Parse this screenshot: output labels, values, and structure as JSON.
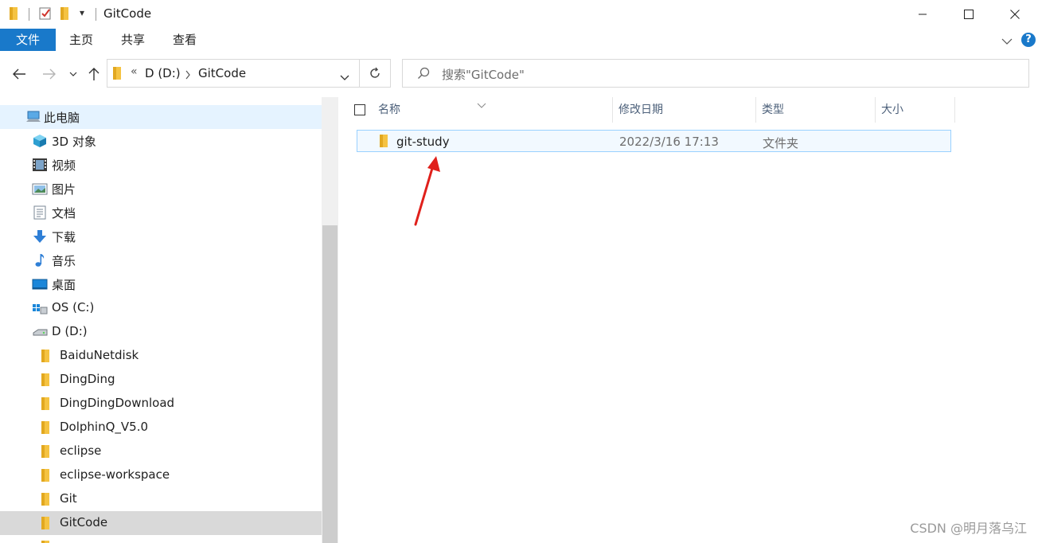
{
  "window": {
    "title": "GitCode",
    "quick_access_dropdown": "▾"
  },
  "ribbon": {
    "tabs": [
      {
        "label": "文件"
      },
      {
        "label": "主页"
      },
      {
        "label": "共享"
      },
      {
        "label": "查看"
      }
    ],
    "help": "?"
  },
  "address": {
    "prefix": "«",
    "path": [
      {
        "label": "D (D:)"
      },
      {
        "label": "GitCode"
      }
    ],
    "search_placeholder": "搜索\"GitCode\""
  },
  "nav": {
    "items": [
      {
        "label": "此电脑",
        "icon": "computer-icon"
      },
      {
        "label": "3D 对象",
        "icon": "3d-objects-icon"
      },
      {
        "label": "视频",
        "icon": "video-icon"
      },
      {
        "label": "图片",
        "icon": "pictures-icon"
      },
      {
        "label": "文档",
        "icon": "documents-icon"
      },
      {
        "label": "下载",
        "icon": "downloads-icon"
      },
      {
        "label": "音乐",
        "icon": "music-icon"
      },
      {
        "label": "桌面",
        "icon": "desktop-icon"
      },
      {
        "label": "OS (C:)",
        "icon": "windows-drive-icon"
      },
      {
        "label": "D (D:)",
        "icon": "drive-icon"
      },
      {
        "label": "BaiduNetdisk",
        "icon": "folder-icon"
      },
      {
        "label": "DingDing",
        "icon": "folder-icon"
      },
      {
        "label": "DingDingDownload",
        "icon": "folder-icon"
      },
      {
        "label": "DolphinQ_V5.0",
        "icon": "folder-icon"
      },
      {
        "label": "eclipse",
        "icon": "folder-icon"
      },
      {
        "label": "eclipse-workspace",
        "icon": "folder-icon"
      },
      {
        "label": "Git",
        "icon": "folder-icon"
      },
      {
        "label": "GitCode",
        "icon": "folder-icon"
      }
    ]
  },
  "columns": {
    "name": "名称",
    "date": "修改日期",
    "type": "类型",
    "size": "大小"
  },
  "files": [
    {
      "name": "git-study",
      "date": "2022/3/16 17:13",
      "type": "文件夹",
      "size": ""
    }
  ],
  "watermark": "CSDN @明月落乌江",
  "colors": {
    "accent": "#1979ca",
    "annotation_arrow": "#e0201b",
    "folder": "#f5c342"
  }
}
